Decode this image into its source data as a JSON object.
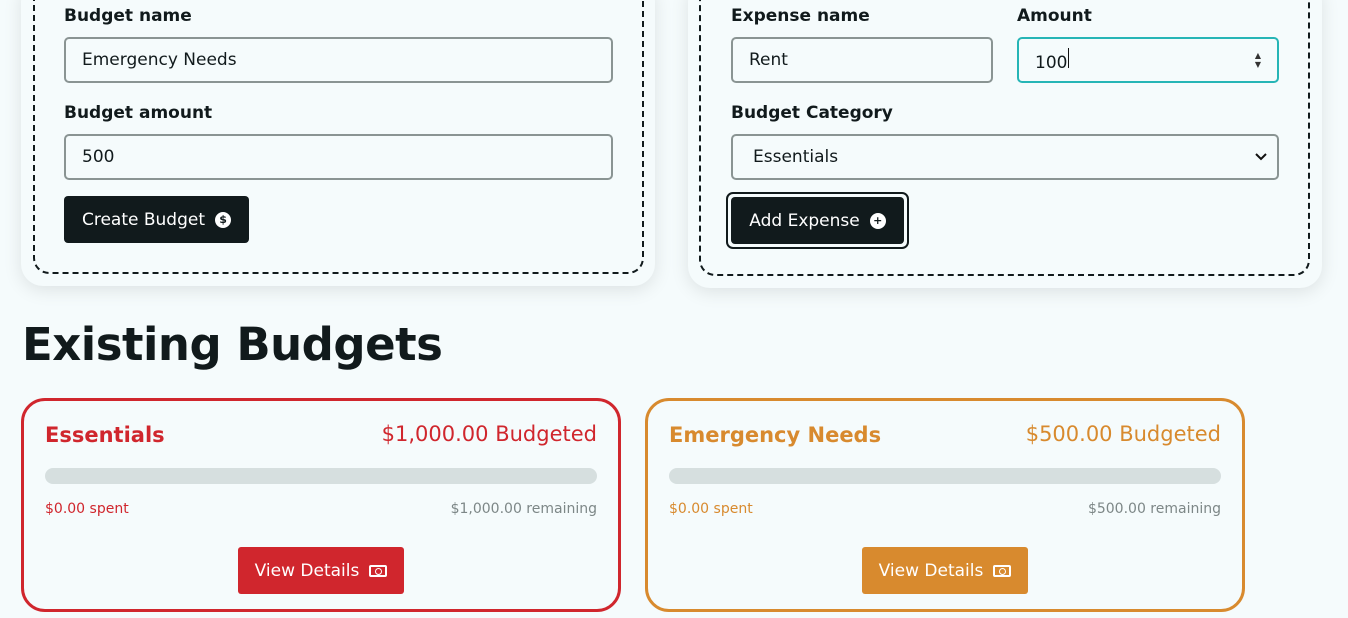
{
  "budget_form": {
    "name_label": "Budget name",
    "name_value": "Emergency Needs",
    "amount_label": "Budget amount",
    "amount_value": "500",
    "submit_label": "Create Budget",
    "submit_icon": "$"
  },
  "expense_form": {
    "name_label": "Expense name",
    "name_value": "Rent",
    "amount_label": "Amount",
    "amount_value": "100",
    "category_label": "Budget Category",
    "category_value": "Essentials",
    "submit_label": "Add Expense",
    "submit_icon": "+"
  },
  "section_title": "Existing Budgets",
  "budgets": [
    {
      "name": "Essentials",
      "budgeted": "$1,000.00 Budgeted",
      "spent": "$0.00 spent",
      "remaining": "$1,000.00 remaining",
      "progress": 0,
      "color": "#d0262d",
      "view_label": "View Details"
    },
    {
      "name": "Emergency Needs",
      "budgeted": "$500.00 Budgeted",
      "spent": "$0.00 spent",
      "remaining": "$500.00 remaining",
      "progress": 0,
      "color": "#d88a2e",
      "view_label": "View Details"
    }
  ]
}
